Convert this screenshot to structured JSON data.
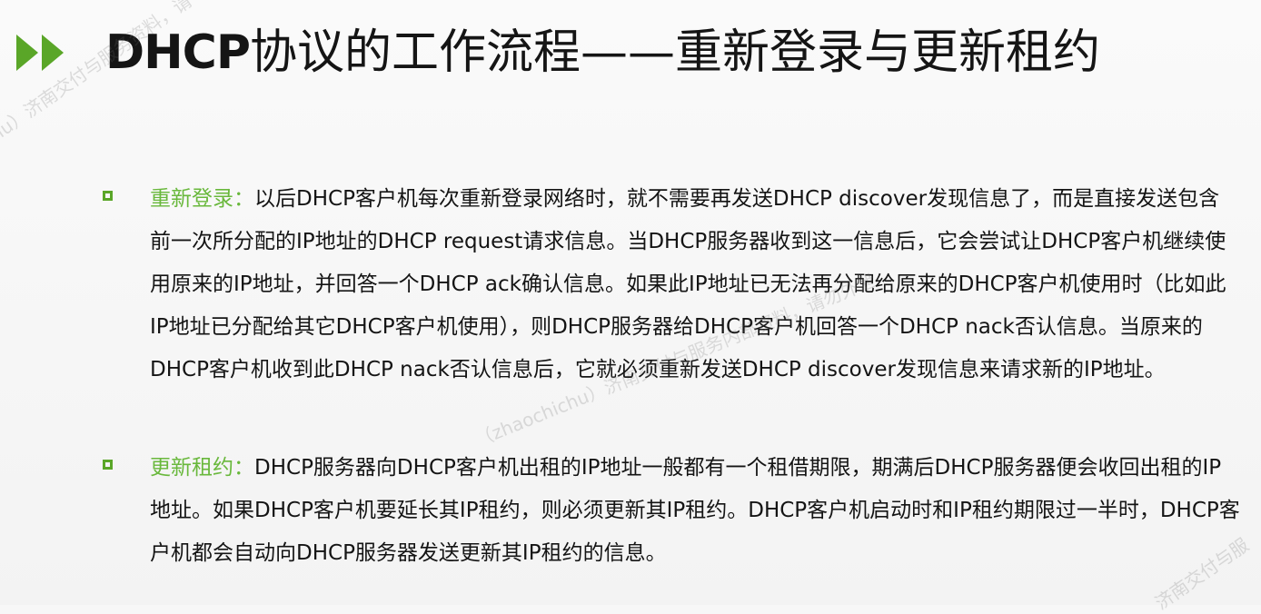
{
  "slide": {
    "title_prefix": "DHCP",
    "title_rest": "协议的工作流程——重新登录与更新租约",
    "colors": {
      "accent_green": "#5aa628",
      "term_green": "#69b83c",
      "background": "#f7f7f7"
    }
  },
  "items": [
    {
      "term": "重新登录：",
      "body": "以后DHCP客户机每次重新登录网络时，就不需要再发送DHCP discover发现信息了，而是直接发送包含前一次所分配的IP地址的DHCP request请求信息。当DHCP服务器收到这一信息后，它会尝试让DHCP客户机继续使用原来的IP地址，并回答一个DHCP ack确认信息。如果此IP地址已无法再分配给原来的DHCP客户机使用时（比如此IP地址已分配给其它DHCP客户机使用），则DHCP服务器给DHCP客户机回答一个DHCP nack否认信息。当原来的DHCP客户机收到此DHCP nack否认信息后，它就必须重新发送DHCP discover发现信息来请求新的IP地址。"
    },
    {
      "term": "更新租约：",
      "body": "DHCP服务器向DHCP客户机出租的IP地址一般都有一个租借期限，期满后DHCP服务器便会收回出租的IP地址。如果DHCP客户机要延长其IP租约，则必须更新其IP租约。DHCP客户机启动时和IP租约期限过一半时，DHCP客户机都会自动向DHCP服务器发送更新其IP租约的信息。"
    }
  ],
  "watermarks": {
    "top_left": "ichu）济南交付与服务资料，请",
    "center": "（zhaochichu）济南交付与服务内部资料，请勿外泄",
    "bottom_right": "济南交付与服"
  },
  "icons": {
    "title_marker": "double-chevron-right-icon",
    "bullet": "hollow-square-bullet-icon"
  }
}
